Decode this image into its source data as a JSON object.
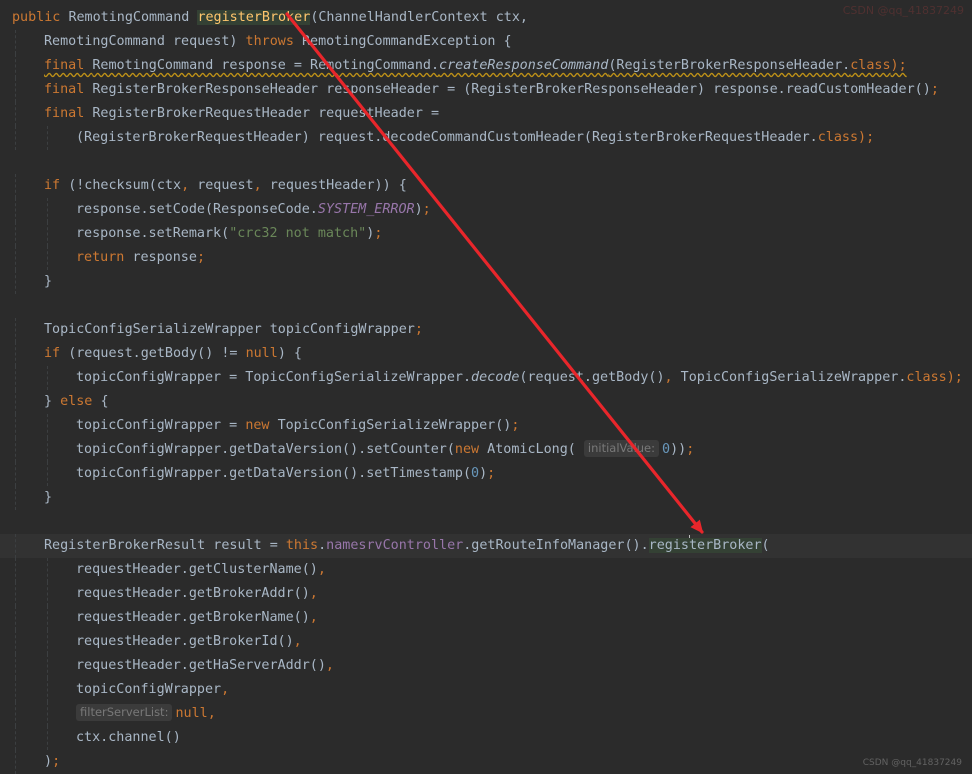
{
  "code": {
    "lines": [
      {
        "indent": 0,
        "tokens": [
          {
            "t": "public ",
            "c": "kw"
          },
          {
            "t": "RemotingCommand "
          },
          {
            "t": "registerBroker",
            "c": "fn-hl"
          },
          {
            "t": "(ChannelHandlerContext ctx,"
          }
        ]
      },
      {
        "indent": 1,
        "tokens": [
          {
            "t": "RemotingCommand request) "
          },
          {
            "t": "throws ",
            "c": "kw"
          },
          {
            "t": "RemotingCommandException {"
          }
        ]
      },
      {
        "indent": 1,
        "warn": true,
        "tokens": [
          {
            "t": "final ",
            "c": "kw"
          },
          {
            "t": "RemotingCommand response = RemotingCommand."
          },
          {
            "t": "createResponseCommand",
            "c": "it"
          },
          {
            "t": "(RegisterBrokerResponseHeader."
          },
          {
            "t": "class",
            "c": "kw"
          },
          {
            "t": ");",
            "c": "kw"
          }
        ]
      },
      {
        "indent": 1,
        "tokens": [
          {
            "t": "final ",
            "c": "kw"
          },
          {
            "t": "RegisterBrokerResponseHeader responseHeader = (RegisterBrokerResponseHeader) response.readCustomHeader()"
          },
          {
            "t": ";",
            "c": "kw"
          }
        ]
      },
      {
        "indent": 1,
        "tokens": [
          {
            "t": "final ",
            "c": "kw"
          },
          {
            "t": "RegisterBrokerRequestHeader requestHeader ="
          }
        ]
      },
      {
        "indent": 2,
        "tokens": [
          {
            "t": "(RegisterBrokerRequestHeader) request.decodeCommandCustomHeader(RegisterBrokerRequestHeader."
          },
          {
            "t": "class",
            "c": "kw"
          },
          {
            "t": ");",
            "c": "kw"
          }
        ]
      },
      {
        "indent": 0,
        "tokens": []
      },
      {
        "indent": 1,
        "tokens": [
          {
            "t": "if ",
            "c": "kw"
          },
          {
            "t": "(!checksum(ctx"
          },
          {
            "t": ", ",
            "c": "kw"
          },
          {
            "t": "request"
          },
          {
            "t": ", ",
            "c": "kw"
          },
          {
            "t": "requestHeader)) {"
          }
        ]
      },
      {
        "indent": 2,
        "tokens": [
          {
            "t": "response.setCode(ResponseCode."
          },
          {
            "t": "SYSTEM_ERROR",
            "c": "cst"
          },
          {
            "t": ")"
          },
          {
            "t": ";",
            "c": "kw"
          }
        ]
      },
      {
        "indent": 2,
        "tokens": [
          {
            "t": "response.setRemark("
          },
          {
            "t": "\"crc32 not match\"",
            "c": "str"
          },
          {
            "t": ")"
          },
          {
            "t": ";",
            "c": "kw"
          }
        ]
      },
      {
        "indent": 2,
        "tokens": [
          {
            "t": "return ",
            "c": "kw"
          },
          {
            "t": "response"
          },
          {
            "t": ";",
            "c": "kw"
          }
        ]
      },
      {
        "indent": 1,
        "tokens": [
          {
            "t": "}"
          }
        ]
      },
      {
        "indent": 0,
        "tokens": []
      },
      {
        "indent": 1,
        "tokens": [
          {
            "t": "TopicConfigSerializeWrapper topicConfigWrapper"
          },
          {
            "t": ";",
            "c": "kw"
          }
        ]
      },
      {
        "indent": 1,
        "tokens": [
          {
            "t": "if ",
            "c": "kw"
          },
          {
            "t": "(request.getBody() != "
          },
          {
            "t": "null",
            "c": "kw"
          },
          {
            "t": ") {"
          }
        ]
      },
      {
        "indent": 2,
        "tokens": [
          {
            "t": "topicConfigWrapper = TopicConfigSerializeWrapper."
          },
          {
            "t": "decode",
            "c": "it"
          },
          {
            "t": "(request.getBody()"
          },
          {
            "t": ", ",
            "c": "kw"
          },
          {
            "t": "TopicConfigSerializeWrapper."
          },
          {
            "t": "class",
            "c": "kw"
          },
          {
            "t": ");",
            "c": "kw"
          }
        ]
      },
      {
        "indent": 1,
        "tokens": [
          {
            "t": "} "
          },
          {
            "t": "else ",
            "c": "kw"
          },
          {
            "t": "{"
          }
        ]
      },
      {
        "indent": 2,
        "tokens": [
          {
            "t": "topicConfigWrapper = "
          },
          {
            "t": "new ",
            "c": "kw"
          },
          {
            "t": "TopicConfigSerializeWrapper()"
          },
          {
            "t": ";",
            "c": "kw"
          }
        ]
      },
      {
        "indent": 2,
        "tokens": [
          {
            "t": "topicConfigWrapper.getDataVersion().setCounter("
          },
          {
            "t": "new ",
            "c": "kw"
          },
          {
            "t": "AtomicLong( "
          },
          {
            "t": "initialValue:",
            "c": "hint"
          },
          {
            "t": "0",
            "c": "num"
          },
          {
            "t": "))"
          },
          {
            "t": ";",
            "c": "kw"
          }
        ]
      },
      {
        "indent": 2,
        "tokens": [
          {
            "t": "topicConfigWrapper.getDataVersion().setTimestamp("
          },
          {
            "t": "0",
            "c": "num"
          },
          {
            "t": ")"
          },
          {
            "t": ";",
            "c": "kw"
          }
        ]
      },
      {
        "indent": 1,
        "tokens": [
          {
            "t": "}"
          }
        ]
      },
      {
        "indent": 0,
        "tokens": []
      },
      {
        "indent": 1,
        "current": true,
        "tokens": [
          {
            "t": "RegisterBrokerResult result = "
          },
          {
            "t": "this",
            "c": "kw"
          },
          {
            "t": "."
          },
          {
            "t": "namesrvController",
            "c": "fld"
          },
          {
            "t": ".getRouteInfoManager()."
          },
          {
            "t": "regis",
            "c": "call-hl"
          },
          {
            "t": "",
            "c": "caret"
          },
          {
            "t": "terBroker",
            "c": "call-hl"
          },
          {
            "t": "("
          }
        ]
      },
      {
        "indent": 2,
        "tokens": [
          {
            "t": "requestHeader.getClusterName()"
          },
          {
            "t": ",",
            "c": "kw"
          }
        ]
      },
      {
        "indent": 2,
        "tokens": [
          {
            "t": "requestHeader.getBrokerAddr()"
          },
          {
            "t": ",",
            "c": "kw"
          }
        ]
      },
      {
        "indent": 2,
        "tokens": [
          {
            "t": "requestHeader.getBrokerName()"
          },
          {
            "t": ",",
            "c": "kw"
          }
        ]
      },
      {
        "indent": 2,
        "tokens": [
          {
            "t": "requestHeader.getBrokerId()"
          },
          {
            "t": ",",
            "c": "kw"
          }
        ]
      },
      {
        "indent": 2,
        "tokens": [
          {
            "t": "requestHeader.getHaServerAddr()"
          },
          {
            "t": ",",
            "c": "kw"
          }
        ]
      },
      {
        "indent": 2,
        "tokens": [
          {
            "t": "topicConfigWrapper"
          },
          {
            "t": ",",
            "c": "kw"
          }
        ]
      },
      {
        "indent": 2,
        "tokens": [
          {
            "t": "filterServerList:",
            "c": "hint"
          },
          {
            "t": "null",
            "c": "kw"
          },
          {
            "t": ",",
            "c": "kw"
          }
        ]
      },
      {
        "indent": 2,
        "tokens": [
          {
            "t": "ctx.channel()"
          }
        ]
      },
      {
        "indent": 1,
        "tokens": [
          {
            "t": ")"
          },
          {
            "t": ";",
            "c": "kw"
          }
        ]
      }
    ]
  },
  "annotation": {
    "arrow_color": "#e8262b",
    "description": "red arrow pointing from registerBroker declaration to registerBroker call"
  },
  "watermark": {
    "top_right": "CSDN @qq_41837249",
    "bottom_right": "CSDN @qq_41837249"
  },
  "theme": {
    "background": "#2b2b2b",
    "keyword": "#cc7832",
    "method_decl": "#ffc66d",
    "string": "#6a8759",
    "number": "#6897bb",
    "field": "#9876aa",
    "default_text": "#a9b7c6"
  }
}
